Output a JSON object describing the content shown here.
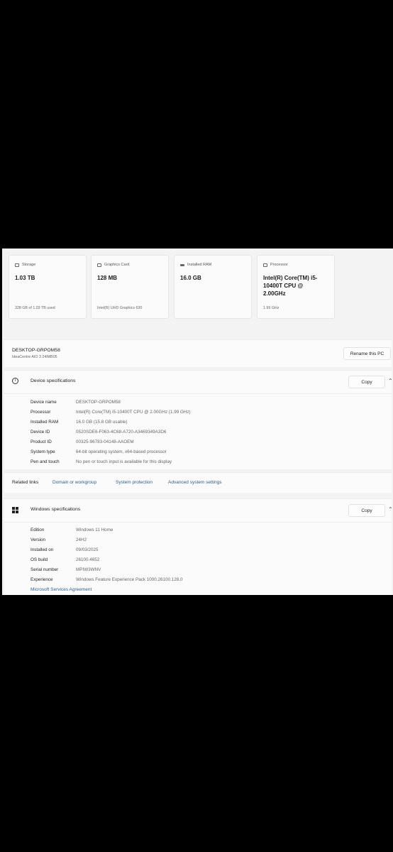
{
  "cards": [
    {
      "icon": "storage-icon",
      "title": "Storage",
      "value": "1.03 TB",
      "sub": "328 GB of 1.03 TB used"
    },
    {
      "icon": "graphics-card-icon",
      "title": "Graphics Card",
      "value": "128 MB",
      "sub": "Intel(R) UHD Graphics 630"
    },
    {
      "icon": "ram-icon",
      "title": "Installed RAM",
      "value": "16.0 GB",
      "sub": ""
    },
    {
      "icon": "processor-icon",
      "title": "Processor",
      "value": "Intel(R) Core(TM) i5-10400T CPU @ 2.00GHz",
      "sub": "1.99 GHz"
    }
  ],
  "pc": {
    "name": "DESKTOP-GRPOM58",
    "model": "IdeaCentre AIO 3 24IMB05",
    "rename_label": "Rename this PC"
  },
  "device_specs": {
    "title": "Device specifications",
    "copy_label": "Copy",
    "rows": [
      {
        "label": "Device name",
        "value": "DESKTOP-GRPOM58"
      },
      {
        "label": "Processor",
        "value": "Intel(R) Core(TM) i5-10400T CPU @ 2.00GHz (1.99 GHz)"
      },
      {
        "label": "Installed RAM",
        "value": "16.0 GB (15.8 GB usable)"
      },
      {
        "label": "Device ID",
        "value": "0520SDE6-F063-4C68-A720-A3469349A3D6"
      },
      {
        "label": "Product ID",
        "value": "00325-96783-04148-AAOEM"
      },
      {
        "label": "System type",
        "value": "64-bit operating system, x64-based processor"
      },
      {
        "label": "Pen and touch",
        "value": "No pen or touch input is available for this display"
      }
    ]
  },
  "related_links": {
    "label": "Related links",
    "links": [
      "Domain or workgroup",
      "System protection",
      "Advanced system settings"
    ]
  },
  "windows_specs": {
    "title": "Windows specifications",
    "copy_label": "Copy",
    "rows": [
      {
        "label": "Edition",
        "value": "Windows 11 Home"
      },
      {
        "label": "Version",
        "value": "24H2"
      },
      {
        "label": "Installed on",
        "value": "09/03/2025"
      },
      {
        "label": "OS build",
        "value": "26100.4652"
      },
      {
        "label": "Serial number",
        "value": "MPIW3WNV"
      },
      {
        "label": "Experience",
        "value": "Windows Feature Experience Pack 1000.26100.128.0"
      }
    ],
    "link": "Microsoft Services Agreement"
  }
}
